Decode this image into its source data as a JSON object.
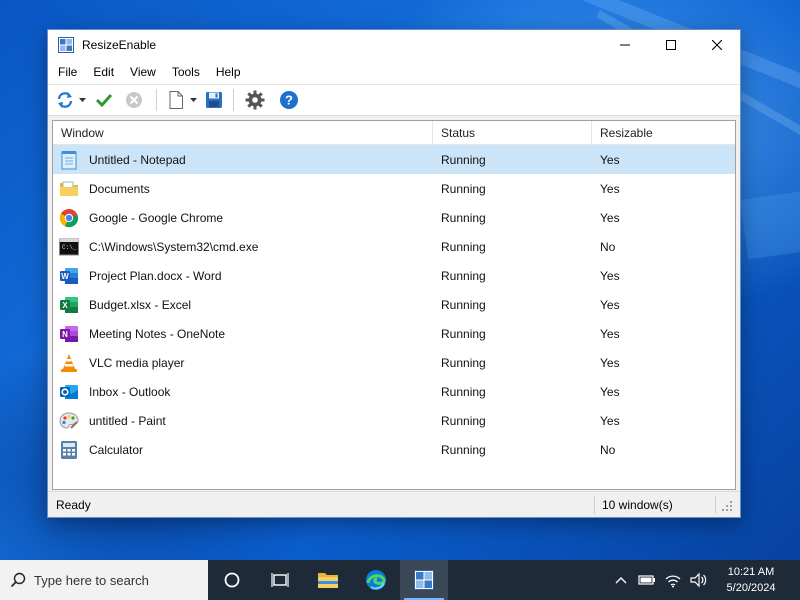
{
  "window": {
    "title": "ResizeEnable"
  },
  "menu": {
    "items": [
      {
        "label": "File"
      },
      {
        "label": "Edit"
      },
      {
        "label": "View"
      },
      {
        "label": "Tools"
      },
      {
        "label": "Help"
      }
    ]
  },
  "toolbar": {
    "buttons": [
      {
        "icon": "refresh-icon"
      },
      {
        "icon": "check-icon"
      },
      {
        "icon": "cancel-icon"
      },
      {
        "icon": "new-file-icon"
      },
      {
        "icon": "save-icon"
      },
      {
        "icon": "gear-icon"
      },
      {
        "icon": "help-icon"
      }
    ]
  },
  "list": {
    "columns": [
      "Window",
      "Status",
      "Resizable"
    ],
    "rows": [
      {
        "icon": "notepad-icon",
        "window": "Untitled - Notepad",
        "status": "Running",
        "resizable": "Yes",
        "selected": true
      },
      {
        "icon": "documents-folder-icon",
        "window": "Documents",
        "status": "Running",
        "resizable": "Yes"
      },
      {
        "icon": "chrome-icon",
        "window": "Google - Google Chrome",
        "status": "Running",
        "resizable": "Yes"
      },
      {
        "icon": "cmd-icon",
        "window": "C:\\Windows\\System32\\cmd.exe",
        "status": "Running",
        "resizable": "No"
      },
      {
        "icon": "word-icon",
        "window": "Project Plan.docx - Word",
        "status": "Running",
        "resizable": "Yes"
      },
      {
        "icon": "excel-icon",
        "window": "Budget.xlsx - Excel",
        "status": "Running",
        "resizable": "Yes"
      },
      {
        "icon": "onenote-icon",
        "window": "Meeting Notes - OneNote",
        "status": "Running",
        "resizable": "Yes"
      },
      {
        "icon": "vlc-icon",
        "window": "VLC media player",
        "status": "Running",
        "resizable": "Yes"
      },
      {
        "icon": "outlook-icon",
        "window": "Inbox - Outlook",
        "status": "Running",
        "resizable": "Yes"
      },
      {
        "icon": "paint-icon",
        "window": "untitled - Paint",
        "status": "Running",
        "resizable": "Yes"
      },
      {
        "icon": "calculator-icon",
        "window": "Calculator",
        "status": "Running",
        "resizable": "No"
      }
    ]
  },
  "status": {
    "left": "Ready",
    "count": "10 window(s)"
  },
  "taskbar": {
    "search_placeholder": "Type here to search",
    "time": "10:21 AM",
    "date": "5/20/2024"
  },
  "colors": {
    "selection": "#cce4f7",
    "accent": "#0078d7",
    "taskbar": "#1f2a38"
  }
}
